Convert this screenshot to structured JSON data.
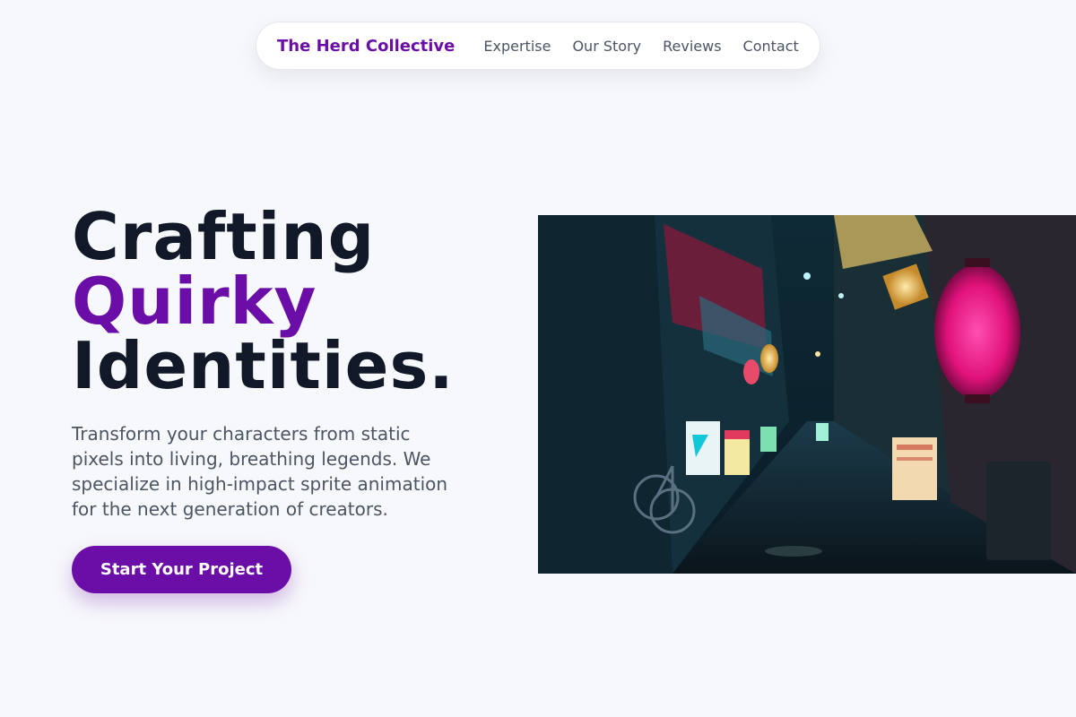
{
  "nav": {
    "brand": "The Herd Collective",
    "links": [
      {
        "label": "Expertise"
      },
      {
        "label": "Our Story"
      },
      {
        "label": "Reviews"
      },
      {
        "label": "Contact"
      }
    ]
  },
  "hero": {
    "title_line1": "Crafting",
    "title_line2": "Quirky",
    "title_line3": "Identities.",
    "subtitle": "Transform your characters from static pixels into living, breathing legends. We specialize in high-impact sprite animation for the next generation of creators.",
    "cta_label": "Start Your Project",
    "image_description": "neon-lit alley street at night"
  },
  "colors": {
    "brand": "#6b0ea8",
    "heading": "#111827",
    "body": "#4b5563",
    "background": "#f7f8fb"
  }
}
